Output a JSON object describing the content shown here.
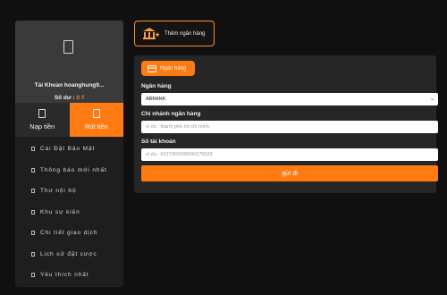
{
  "account": {
    "name": "Tài Khoản hoanghung9...",
    "balance_label": "Số dư :",
    "balance_value": "0",
    "currency": "₫"
  },
  "tabs": [
    {
      "label": "Nạp tiền"
    },
    {
      "label": "Rút tiền"
    }
  ],
  "menu": [
    {
      "label": "Cài Đặt Bảo Mật"
    },
    {
      "label": "Thông báo mới nhất"
    },
    {
      "label": "Thư nội bộ"
    },
    {
      "label": "Khu sự kiện"
    },
    {
      "label": "Chi tiết giao dịch"
    },
    {
      "label": "Lịch sử đặt cược"
    },
    {
      "label": "Yêu thích nhất"
    }
  ],
  "add_bank_button": {
    "label": "Thêm ngân hàng"
  },
  "form": {
    "chip_label": "Ngân hàng",
    "bank_label": "Ngân hàng",
    "bank_value": "ABBANK",
    "branch_label": "Chi nhánh ngân hàng",
    "branch_placeholder": "ví dụ : thành phố hồ chí minh",
    "account_label": "Số tài khoản",
    "account_placeholder": "ví dụ : 622700200009017552​8",
    "submit_label": "gửi đi"
  },
  "colors": {
    "accent": "#ff7b12",
    "background": "#101010",
    "panel": "#262626",
    "sidebar": "#1e1e1e"
  },
  "icons": {
    "avatar": "user-icon",
    "deposit": "deposit-icon",
    "withdraw": "withdraw-icon",
    "bank": "bank-icon",
    "card": "card-icon"
  }
}
